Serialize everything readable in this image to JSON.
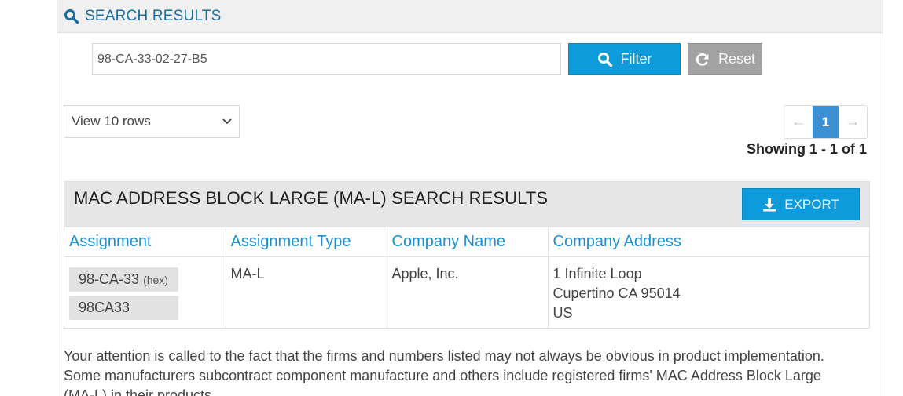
{
  "header": {
    "title": "SEARCH RESULTS",
    "icon": "search-icon"
  },
  "search": {
    "value": "98-CA-33-02-27-B5",
    "filter_label": "Filter",
    "reset_label": "Reset"
  },
  "rows_select": {
    "selected": "View 10 rows"
  },
  "pagination": {
    "prev": "←",
    "current": "1",
    "next": "→",
    "showing": "Showing 1 - 1 of 1"
  },
  "results": {
    "title": "MAC ADDRESS BLOCK LARGE (MA-L) SEARCH RESULTS",
    "export_label": "EXPORT",
    "columns": [
      "Assignment",
      "Assignment Type",
      "Company Name",
      "Company Address"
    ],
    "rows": [
      {
        "assignment_hex": "98-CA-33",
        "assignment_hex_suffix": "(hex)",
        "assignment_base": "98CA33",
        "type": "MA-L",
        "company": "Apple, Inc.",
        "address": [
          "1 Infinite Loop",
          "Cupertino CA 95014",
          "US"
        ]
      }
    ]
  },
  "note": "Your attention is called to the fact that the firms and numbers listed may not always be obvious in product implementation. Some manufacturers subcontract component manufacture and others include registered firms' MAC Address Block Large (MA-L) in their products.",
  "colors": {
    "accent": "#0d9bdb",
    "header_text": "#1a6e9e",
    "link": "#1a8fd0",
    "reset": "#a2a2a2",
    "page_active": "#3b8fd3"
  }
}
